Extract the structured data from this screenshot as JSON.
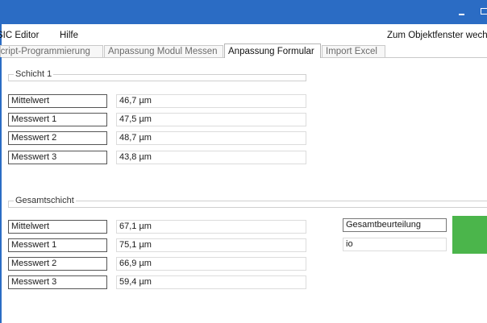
{
  "colors": {
    "titlebar": "#2b6cc4",
    "status_ok": "#4bb54b"
  },
  "menu": {
    "editor": "SIC Editor",
    "help": "Hilfe",
    "right": "Zum Objektfenster wechs"
  },
  "tabs": [
    {
      "label": "Script-Programmierung",
      "active": false
    },
    {
      "label": "Anpassung Modul Messen",
      "active": false
    },
    {
      "label": "Anpassung Formular",
      "active": true
    },
    {
      "label": "Import Excel",
      "active": false
    }
  ],
  "schicht1": {
    "title": "Schicht 1",
    "rows": [
      {
        "label": "Mittelwert",
        "value": "46,7 µm"
      },
      {
        "label": "Messwert 1",
        "value": "47,5 µm"
      },
      {
        "label": "Messwert 2",
        "value": "48,7 µm"
      },
      {
        "label": "Messwert 3",
        "value": "43,8 µm"
      }
    ]
  },
  "gesamt": {
    "title": "Gesamtschicht",
    "rows": [
      {
        "label": "Mittelwert",
        "value": "67,1 µm"
      },
      {
        "label": "Messwert 1",
        "value": "75,1 µm"
      },
      {
        "label": "Messwert 2",
        "value": "66,9 µm"
      },
      {
        "label": "Messwert 3",
        "value": "59,4 µm"
      }
    ],
    "assessment_label": "Gesamtbeurteilung",
    "assessment_value": "io",
    "assessment_status": "green"
  }
}
